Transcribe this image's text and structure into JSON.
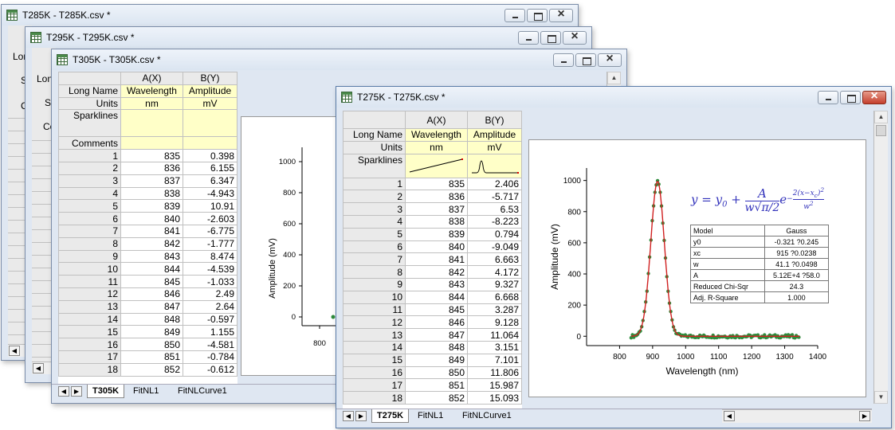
{
  "windows": {
    "w285": {
      "title": "T285K - T285K.csv *",
      "partial_rows": [
        "Lon",
        "S",
        "C"
      ]
    },
    "w295": {
      "title": "T295K - T295K.csv *",
      "partial_rows": [
        "Lon",
        "S",
        "Co"
      ]
    },
    "w305": {
      "title": "T305K - T305K.csv *",
      "col_a": "A(X)",
      "col_b": "B(Y)",
      "long_name_label": "Long Name",
      "units_label": "Units",
      "sparklines_label": "Sparklines",
      "comments_label": "Comments",
      "a_long_name": "Wavelength",
      "b_long_name": "Amplitude",
      "a_units": "nm",
      "b_units": "mV",
      "rows": [
        {
          "n": "1",
          "x": "835",
          "y": "0.398"
        },
        {
          "n": "2",
          "x": "836",
          "y": "6.155"
        },
        {
          "n": "3",
          "x": "837",
          "y": "6.347"
        },
        {
          "n": "4",
          "x": "838",
          "y": "-4.943"
        },
        {
          "n": "5",
          "x": "839",
          "y": "10.91"
        },
        {
          "n": "6",
          "x": "840",
          "y": "-2.603"
        },
        {
          "n": "7",
          "x": "841",
          "y": "-6.775"
        },
        {
          "n": "8",
          "x": "842",
          "y": "-1.777"
        },
        {
          "n": "9",
          "x": "843",
          "y": "8.474"
        },
        {
          "n": "10",
          "x": "844",
          "y": "-4.539"
        },
        {
          "n": "11",
          "x": "845",
          "y": "-1.033"
        },
        {
          "n": "12",
          "x": "846",
          "y": "2.49"
        },
        {
          "n": "13",
          "x": "847",
          "y": "2.64"
        },
        {
          "n": "14",
          "x": "848",
          "y": "-0.597"
        },
        {
          "n": "15",
          "x": "849",
          "y": "1.155"
        },
        {
          "n": "16",
          "x": "850",
          "y": "-4.581"
        },
        {
          "n": "17",
          "x": "851",
          "y": "-0.784"
        },
        {
          "n": "18",
          "x": "852",
          "y": "-0.612"
        }
      ],
      "graph": {
        "ylabel": "Amplitude (mV)",
        "yticks": [
          "0",
          "200",
          "400",
          "600",
          "800",
          "1000"
        ],
        "xticks": [
          "800"
        ]
      },
      "tabs": [
        "T305K",
        "FitNL1",
        "FitNLCurve1"
      ]
    },
    "w275": {
      "title": "T275K - T275K.csv *",
      "col_a": "A(X)",
      "col_b": "B(Y)",
      "long_name_label": "Long Name",
      "units_label": "Units",
      "sparklines_label": "Sparklines",
      "a_long_name": "Wavelength",
      "b_long_name": "Amplitude",
      "a_units": "nm",
      "b_units": "mV",
      "rows": [
        {
          "n": "1",
          "x": "835",
          "y": "2.406"
        },
        {
          "n": "2",
          "x": "836",
          "y": "-5.717"
        },
        {
          "n": "3",
          "x": "837",
          "y": "6.53"
        },
        {
          "n": "4",
          "x": "838",
          "y": "-8.223"
        },
        {
          "n": "5",
          "x": "839",
          "y": "0.794"
        },
        {
          "n": "6",
          "x": "840",
          "y": "-9.049"
        },
        {
          "n": "7",
          "x": "841",
          "y": "6.663"
        },
        {
          "n": "8",
          "x": "842",
          "y": "4.172"
        },
        {
          "n": "9",
          "x": "843",
          "y": "9.327"
        },
        {
          "n": "10",
          "x": "844",
          "y": "6.668"
        },
        {
          "n": "11",
          "x": "845",
          "y": "3.287"
        },
        {
          "n": "12",
          "x": "846",
          "y": "9.128"
        },
        {
          "n": "13",
          "x": "847",
          "y": "11.064"
        },
        {
          "n": "14",
          "x": "848",
          "y": "3.151"
        },
        {
          "n": "15",
          "x": "849",
          "y": "7.101"
        },
        {
          "n": "16",
          "x": "850",
          "y": "11.806"
        },
        {
          "n": "17",
          "x": "851",
          "y": "15.987"
        },
        {
          "n": "18",
          "x": "852",
          "y": "15.093"
        }
      ],
      "tabs": [
        "T275K",
        "FitNL1",
        "FitNLCurve1"
      ],
      "fit_table": {
        "header": [
          "Model",
          "Gauss"
        ],
        "rows": [
          [
            "y0",
            "-0.321 ?0.245"
          ],
          [
            "xc",
            "915 ?0.0238"
          ],
          [
            "w",
            "41.1 ?0.0498"
          ],
          [
            "A",
            "5.12E+4 ?58.0"
          ],
          [
            "Reduced Chi-Sqr",
            "24.3"
          ],
          [
            "Adj. R-Square",
            "1.000"
          ]
        ]
      }
    }
  },
  "chart_data": {
    "type": "scatter",
    "title": "",
    "xlabel": "Wavelength (nm)",
    "ylabel": "Amplitude (mV)",
    "xlim": [
      700,
      1400
    ],
    "ylim": [
      -60,
      1080
    ],
    "xticks": [
      "800",
      "900",
      "1000",
      "1100",
      "1200",
      "1300",
      "1400"
    ],
    "yticks": [
      "0",
      "200",
      "400",
      "600",
      "800",
      "1000"
    ],
    "x_range": [
      835,
      1345
    ],
    "gauss": {
      "y0": -0.321,
      "xc": 915,
      "w": 41.1,
      "A": 51200
    },
    "series": [
      {
        "name": "",
        "kind": "scatter",
        "color": "#2e8b3c"
      },
      {
        "name": "",
        "kind": "fit-line",
        "color": "#d02020"
      }
    ]
  }
}
